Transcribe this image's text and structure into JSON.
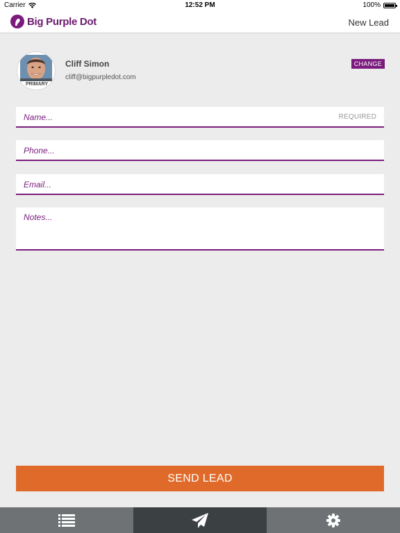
{
  "status_bar": {
    "carrier": "Carrier",
    "time": "12:52 PM",
    "battery": "100%"
  },
  "nav": {
    "brand": "Big Purple Dot",
    "title": "New Lead"
  },
  "profile": {
    "name": "Cliff Simon",
    "email": "cliff@bigpurpledot.com",
    "badge": "PRIMARY",
    "change_label": "CHANGE"
  },
  "form": {
    "name_placeholder": "Name...",
    "name_required": "REQUIRED",
    "phone_placeholder": "Phone...",
    "email_placeholder": "Email...",
    "notes_placeholder": "Notes..."
  },
  "send_label": "SEND LEAD",
  "tabs": [
    {
      "icon": "list-icon",
      "active": false
    },
    {
      "icon": "paper-plane-icon",
      "active": true
    },
    {
      "icon": "gear-icon",
      "active": false
    }
  ],
  "colors": {
    "brand_purple": "#7a1b7d",
    "accent_orange": "#e06a2a",
    "tab_bar": "#6e7274",
    "tab_active": "#3b4043"
  }
}
